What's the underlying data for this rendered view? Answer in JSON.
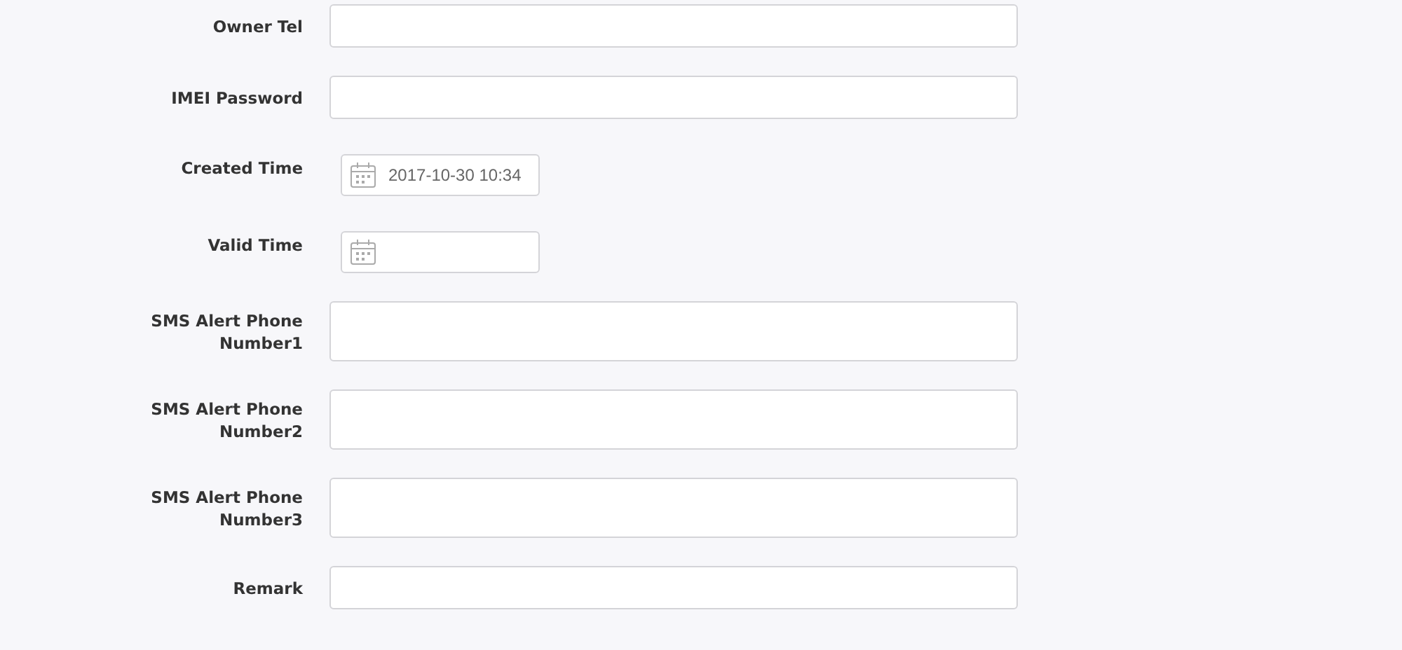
{
  "fields": [
    {
      "label": "Owner Tel",
      "kind": "text"
    },
    {
      "label": "IMEI Password",
      "kind": "text"
    },
    {
      "label": "Created Time",
      "kind": "date",
      "value": "2017-10-30 10:34"
    },
    {
      "label": "Valid Time",
      "kind": "date"
    },
    {
      "label": "SMS Alert Phone Number1",
      "kind": "textarea"
    },
    {
      "label": "SMS Alert Phone Number2",
      "kind": "textarea"
    },
    {
      "label": "SMS Alert Phone Number3",
      "kind": "textarea"
    },
    {
      "label": "Remark",
      "kind": "text"
    }
  ]
}
